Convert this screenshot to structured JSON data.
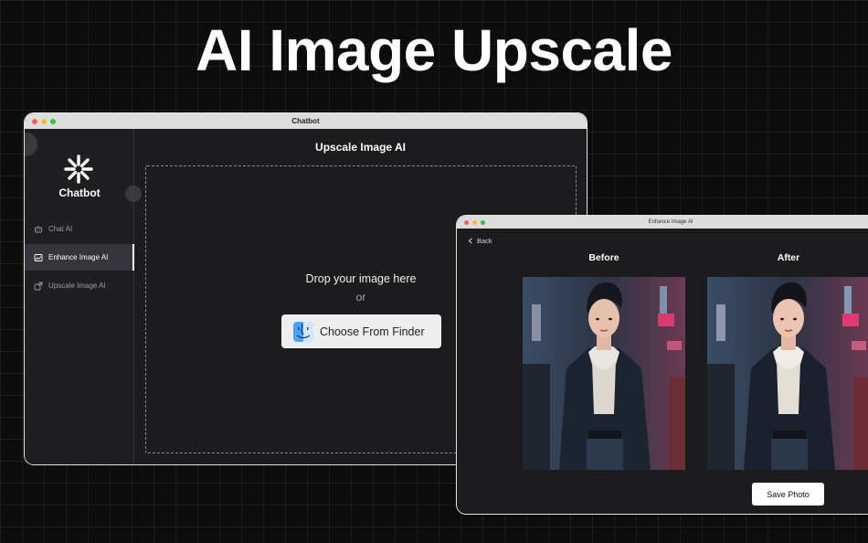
{
  "headline": "AI Image Upscale",
  "main_window": {
    "title": "Chatbot",
    "brand": "Chatbot",
    "sidebar": {
      "items": [
        {
          "label": "Chat AI",
          "icon": "chat-bot-icon",
          "active": false
        },
        {
          "label": "Enhance Image AI",
          "icon": "enhance-image-icon",
          "active": true
        },
        {
          "label": "Upscale Image AI",
          "icon": "upscale-image-icon",
          "active": false
        }
      ]
    },
    "content": {
      "title": "Upscale Image AI",
      "drop_text": "Drop your image here",
      "or_text": "or",
      "finder_button": "Choose From Finder"
    }
  },
  "enhance_window": {
    "title": "Enhance Image AI",
    "back_label": "Back",
    "before_label": "Before",
    "after_label": "After",
    "save_button": "Save Photo"
  },
  "colors": {
    "background": "#0c0c0d",
    "window_bg": "#1c1c1f",
    "titlebar": "#dddddd",
    "traffic_red": "#ff5f57",
    "traffic_yellow": "#febc2e",
    "traffic_green": "#28c840",
    "sidebar_active": "#35353b"
  }
}
